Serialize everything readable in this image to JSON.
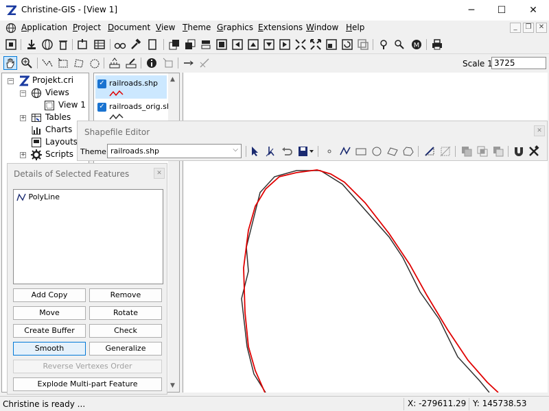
{
  "window": {
    "title": "Christine-GIS - [View 1]",
    "controls": {
      "minimize": "─",
      "maximize": "☐",
      "close": "✕"
    }
  },
  "menubar": {
    "items": [
      "Application",
      "Project",
      "Document",
      "View",
      "Theme",
      "Graphics",
      "Extensions",
      "Window",
      "Help"
    ],
    "mdi": {
      "minimize": "_",
      "restore": "❐",
      "close": "✕"
    }
  },
  "toolbar2": {
    "scale_label": "Scale 1:",
    "scale_value": "3725"
  },
  "project_tree": {
    "items": [
      {
        "label": "Projekt.cri",
        "icon": "project-icon"
      },
      {
        "label": "Views",
        "icon": "globe-icon"
      },
      {
        "label": "View 1",
        "icon": "map-view-icon"
      },
      {
        "label": "Tables",
        "icon": "table-icon"
      },
      {
        "label": "Charts",
        "icon": "chart-icon"
      },
      {
        "label": "Layouts",
        "icon": "layout-icon"
      },
      {
        "label": "Scripts",
        "icon": "gear-icon"
      }
    ]
  },
  "legend": {
    "layers": [
      {
        "name": "railroads.shp",
        "color": "#e00000",
        "checked": true,
        "selected": true
      },
      {
        "name": "railroads_orig.shp",
        "color": "#303030",
        "checked": true,
        "selected": false
      }
    ]
  },
  "shapefile_editor": {
    "title": "Shapefile Editor",
    "theme_label": "Theme:",
    "theme_value": "railroads.shp"
  },
  "details": {
    "title": "Details of Selected Features",
    "features": [
      "PolyLine"
    ],
    "buttons": {
      "add_copy": "Add Copy",
      "remove": "Remove",
      "move": "Move",
      "rotate": "Rotate",
      "create_buffer": "Create Buffer",
      "check": "Check",
      "smooth": "Smooth",
      "generalize": "Generalize",
      "reverse": "Reverse Vertexes Order",
      "explode": "Explode Multi-part Feature"
    }
  },
  "status": {
    "message": "Christine is ready ...",
    "x": "X: -279611.29",
    "y": "Y: 145738.53"
  },
  "colors": {
    "smoothed_line": "#e00000",
    "original_line": "#303030",
    "selection": "#cce8ff",
    "accent": "#0078d7"
  }
}
